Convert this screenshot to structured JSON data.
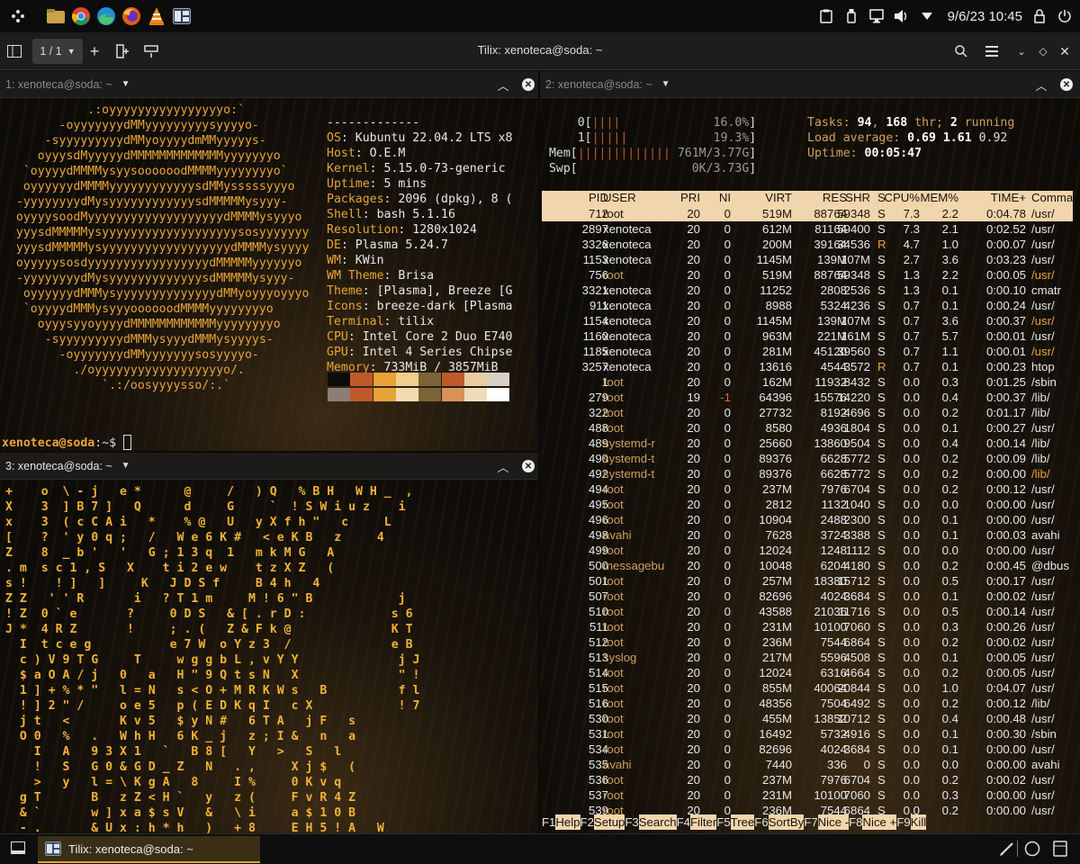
{
  "topbar": {
    "datetime": "9/6/23 10:45",
    "apps": [
      "app-launcher-icon",
      "file-manager-icon",
      "chrome-icon",
      "edge-icon",
      "firefox-icon",
      "vlc-icon",
      "tilix-icon"
    ]
  },
  "window": {
    "title": "Tilix: xenoteca@soda: ~",
    "session_label": "1 / 1"
  },
  "panes": {
    "p1": {
      "title": "1: xenoteca@soda: ~"
    },
    "p2": {
      "title": "2: xenoteca@soda: ~"
    },
    "p3": {
      "title": "3: xenoteca@soda: ~"
    }
  },
  "neofetch": {
    "separator": "-------------",
    "info": [
      {
        "k": "OS",
        "v": " Kubuntu 22.04.2 LTS x8"
      },
      {
        "k": "Host",
        "v": " O.E.M"
      },
      {
        "k": "Kernel",
        "v": " 5.15.0-73-generic"
      },
      {
        "k": "Uptime",
        "v": " 5 mins"
      },
      {
        "k": "Packages",
        "v": " 2096 (dpkg), 8 ("
      },
      {
        "k": "Shell",
        "v": " bash 5.1.16"
      },
      {
        "k": "Resolution",
        "v": " 1280x1024"
      },
      {
        "k": "DE",
        "v": " Plasma 5.24.7"
      },
      {
        "k": "WM",
        "v": " KWin"
      },
      {
        "k": "WM Theme",
        "v": " Brisa"
      },
      {
        "k": "Theme",
        "v": " [Plasma], Breeze [G"
      },
      {
        "k": "Icons",
        "v": " breeze-dark [Plasma"
      },
      {
        "k": "Terminal",
        "v": " tilix"
      },
      {
        "k": "CPU",
        "v": " Intel Core 2 Duo E740"
      },
      {
        "k": "GPU",
        "v": " Intel 4 Series Chipse"
      },
      {
        "k": "Memory",
        "v": " 733MiB / 3857MiB"
      }
    ],
    "logo": [
      "            .:oyyyyyyyyyyyyyyyyo:`",
      "        -oyyyyyyydMMyyyyyyyyysyyyyo-",
      "      -syyyyyyyyydMMyoyyyydmMMyyyyys-",
      "     oyyysdMyyyyydMMMMMMMMMMMMMyyyyyyyo",
      "   `oyyyydMMMMysyysoooooodMMMMyyyyyyyyo`",
      "   oyyyyyydMMMMyyyyyyyyyyyysdMMysssssyyyo",
      "  -yyyyyyyydMysyyyyyyyyyyyysdMMMMMysyyy-",
      "  oyyyysoodMyyyyyyyyyyyyyyyyyyydMMMMysyyyo",
      "  yyysdMMMMMysyyyyyyyyyyyyyyyyyyysosyyyyyyy",
      "  yyysdMMMMMysyyyyyyyyyyyyyyyyyydMMMMysyyyy",
      "  oyyyyysosdyyyyyyyyyyyyyyyyydMMMMMyyyyyyo",
      "  -yyyyyyyydMysyyyyyyyyyyyyysdMMMMMysyyy-",
      "   oyyyyyydMMMysyyyyyyyyyyyyyydMMyoyyyoyyyo",
      "   `oyyyydMMMysyyyoooooodMMMMyyyyyyyyo",
      "     oyyysyyoyyyydMMMMMMMMMMMMyyyyyyyyo",
      "      -syyyyyyyyydMMMysyyydMMMysyyyys-",
      "        -oyyyyyyydMMyyyyyyysosyyyyo-",
      "          ./oyyyyyyyyyyyyyyyyyyo/.",
      "              `.:/oosyyyysso/:.`"
    ],
    "palette_top": [
      "#0d0b08",
      "#c0592a",
      "#e8a338",
      "#f2cf8c",
      "#7c6438",
      "#c0592a",
      "#e8cca3",
      "#d9cfc4"
    ],
    "palette_bottom": [
      "#8a7f72",
      "#c0592a",
      "#e8a338",
      "#f5dcb0",
      "#7c6438",
      "#d8925a",
      "#f0dcbc",
      "#ffffff"
    ]
  },
  "prompt": {
    "user": "xenoteca@soda",
    "rest": ":~$ "
  },
  "matrix": [
    "+    o  \\ - j   e *      @     /   ) Q   % B H   W H _  ,",
    "X    3  ] B 7 ]   Q      d     G     `  ! S W i u z    i",
    "x    3  ( c C A i   *    % @   U   y X f h \"   c     L",
    "[    ?  ' y 0 q ;   /   W e 6 K #   < e K B   z     4",
    "Z    8  _ b '   '   G ; 1 3 q  1   m k M G   A",
    ". m  s c 1 , S   X    t i 2 e w    t z X Z   (",
    "s !    ! ]   ]     K   J D S f     B 4 h   4",
    "Z Z   ' ' R       i   ? T 1 m     M ! 6 \" B            j",
    "! Z  0 ` e       ?     0 D S   & [ . r D :            s 6",
    "J *  4 R Z       !     ; . (   Z & F k @              K T",
    "  I  t c e g           e 7 W  o Y z 3  /              e B",
    "  c ) V 9 T G     T     w g g b L , v Y Y              j J",
    "  $ a O A / j   0   a   H \" 9 Q t s N   X              \" !",
    "  1 ] + % * \"   l = N   s < O + M R K W s   B          f l",
    "  ! ] 2 \" /     o e 5   p ( E D K q I   c X            ! 7",
    "  j t   <       K v 5   $ y N #   6 T A   j F   s",
    "  O 0   %   .   W h H   6 K _ j   z ; I &   n   a",
    "    I   A   9 3 X 1   `   B 8 [   Y   >   S   l",
    "    !   S   G 0 & G D _ Z   N   . ,     X j $   (",
    "    >   y   l = \\ K g A   8     I %     0 K v q",
    "  g T       B   z Z < H `   y   z (     F v R 4 Z",
    "  & `       w ] x a $ s V   &   \\ i     a $ 1 0 B",
    "  - .       & U x : h * h   )   + 8     E H 5 ! A   W"
  ],
  "htop": {
    "cpu0": {
      "label": "0",
      "bar": "||||",
      "pct": "16.0%"
    },
    "cpu1": {
      "label": "1",
      "bar": "|||||",
      "pct": "19.3%"
    },
    "mem": {
      "label": "Mem",
      "bar": "|||||||||||||",
      "val": "761M/3.77G"
    },
    "swp": {
      "label": "Swp",
      "bar": "",
      "val": "0K/3.73G"
    },
    "tasks": {
      "label": "Tasks: ",
      "n": "94",
      "sep": ", ",
      "thr": "168",
      "thr_label": " thr; ",
      "running": "2",
      "running_label": " running"
    },
    "load": {
      "label": "Load average: ",
      "l1": "0.69",
      "l5": "1.61",
      "l15": "0.92"
    },
    "uptime": {
      "label": "Uptime: ",
      "val": "00:05:47"
    },
    "headers": [
      "PID",
      "USER",
      "PRI",
      "NI",
      "VIRT",
      "RES",
      "SHR",
      "S",
      "CPU%",
      "MEM%",
      "TIME+",
      "Comma"
    ],
    "rows": [
      [
        "712",
        "root",
        "20",
        "0",
        "519M",
        "88764",
        "59348",
        "S",
        "7.3",
        "2.2",
        "0:04.78",
        "/usr/"
      ],
      [
        "2897",
        "xenoteca",
        "20",
        "0",
        "612M",
        "81164",
        "59400",
        "S",
        "7.3",
        "2.1",
        "0:02.52",
        "/usr/"
      ],
      [
        "3326",
        "xenoteca",
        "20",
        "0",
        "200M",
        "39164",
        "34536",
        "R",
        "4.7",
        "1.0",
        "0:00.07",
        "/usr/"
      ],
      [
        "1153",
        "xenoteca",
        "20",
        "0",
        "1145M",
        "139M",
        "107M",
        "S",
        "2.7",
        "3.6",
        "0:03.23",
        "/usr/"
      ],
      [
        "756",
        "root",
        "20",
        "0",
        "519M",
        "88764",
        "59348",
        "S",
        "1.3",
        "2.2",
        "0:00.05",
        "/usr/"
      ],
      [
        "3321",
        "xenoteca",
        "20",
        "0",
        "11252",
        "2808",
        "2536",
        "S",
        "1.3",
        "0.1",
        "0:00.10",
        "cmatr"
      ],
      [
        "911",
        "xenoteca",
        "20",
        "0",
        "8988",
        "5324",
        "4236",
        "S",
        "0.7",
        "0.1",
        "0:00.24",
        "/usr/"
      ],
      [
        "1154",
        "xenoteca",
        "20",
        "0",
        "1145M",
        "139M",
        "107M",
        "S",
        "0.7",
        "3.6",
        "0:00.37",
        "/usr/"
      ],
      [
        "1160",
        "xenoteca",
        "20",
        "0",
        "963M",
        "221M",
        "161M",
        "S",
        "0.7",
        "5.7",
        "0:00.01",
        "/usr/"
      ],
      [
        "1185",
        "xenoteca",
        "20",
        "0",
        "281M",
        "45120",
        "39560",
        "S",
        "0.7",
        "1.1",
        "0:00.01",
        "/usr/"
      ],
      [
        "3257",
        "xenoteca",
        "20",
        "0",
        "13616",
        "4544",
        "3572",
        "R",
        "0.7",
        "0.1",
        "0:00.23",
        "htop"
      ],
      [
        "1",
        "root",
        "20",
        "0",
        "162M",
        "11932",
        "8432",
        "S",
        "0.0",
        "0.3",
        "0:01.25",
        "/sbin"
      ],
      [
        "279",
        "root",
        "19",
        "-1",
        "64396",
        "15576",
        "14220",
        "S",
        "0.0",
        "0.4",
        "0:00.37",
        "/lib/"
      ],
      [
        "322",
        "root",
        "20",
        "0",
        "27732",
        "8192",
        "4696",
        "S",
        "0.0",
        "0.2",
        "0:01.17",
        "/lib/"
      ],
      [
        "488",
        "root",
        "20",
        "0",
        "8580",
        "4936",
        "1804",
        "S",
        "0.0",
        "0.1",
        "0:00.27",
        "/usr/"
      ],
      [
        "489",
        "systemd-r",
        "20",
        "0",
        "25660",
        "13860",
        "9504",
        "S",
        "0.0",
        "0.4",
        "0:00.14",
        "/lib/"
      ],
      [
        "490",
        "systemd-t",
        "20",
        "0",
        "89376",
        "6628",
        "5772",
        "S",
        "0.0",
        "0.2",
        "0:00.09",
        "/lib/"
      ],
      [
        "492",
        "systemd-t",
        "20",
        "0",
        "89376",
        "6628",
        "5772",
        "S",
        "0.0",
        "0.2",
        "0:00.00",
        "/lib/"
      ],
      [
        "494",
        "root",
        "20",
        "0",
        "237M",
        "7976",
        "6704",
        "S",
        "0.0",
        "0.2",
        "0:00.12",
        "/usr/"
      ],
      [
        "495",
        "root",
        "20",
        "0",
        "2812",
        "1132",
        "1040",
        "S",
        "0.0",
        "0.0",
        "0:00.00",
        "/usr/"
      ],
      [
        "496",
        "root",
        "20",
        "0",
        "10904",
        "2488",
        "2300",
        "S",
        "0.0",
        "0.1",
        "0:00.00",
        "/usr/"
      ],
      [
        "498",
        "avahi",
        "20",
        "0",
        "7628",
        "3724",
        "3388",
        "S",
        "0.0",
        "0.1",
        "0:00.03",
        "avahi"
      ],
      [
        "499",
        "root",
        "20",
        "0",
        "12024",
        "1248",
        "1112",
        "S",
        "0.0",
        "0.0",
        "0:00.00",
        "/usr/"
      ],
      [
        "500",
        "messagebu",
        "20",
        "0",
        "10048",
        "6204",
        "4180",
        "S",
        "0.0",
        "0.2",
        "0:00.45",
        "@dbus"
      ],
      [
        "501",
        "root",
        "20",
        "0",
        "257M",
        "18380",
        "15712",
        "S",
        "0.0",
        "0.5",
        "0:00.17",
        "/usr/"
      ],
      [
        "507",
        "root",
        "20",
        "0",
        "82696",
        "4024",
        "3684",
        "S",
        "0.0",
        "0.1",
        "0:00.02",
        "/usr/"
      ],
      [
        "510",
        "root",
        "20",
        "0",
        "43588",
        "21036",
        "11716",
        "S",
        "0.0",
        "0.5",
        "0:00.14",
        "/usr/"
      ],
      [
        "511",
        "root",
        "20",
        "0",
        "231M",
        "10100",
        "7060",
        "S",
        "0.0",
        "0.3",
        "0:00.26",
        "/usr/"
      ],
      [
        "512",
        "root",
        "20",
        "0",
        "236M",
        "7544",
        "6864",
        "S",
        "0.0",
        "0.2",
        "0:00.02",
        "/usr/"
      ],
      [
        "513",
        "syslog",
        "20",
        "0",
        "217M",
        "5596",
        "4508",
        "S",
        "0.0",
        "0.1",
        "0:00.05",
        "/usr/"
      ],
      [
        "514",
        "root",
        "20",
        "0",
        "12024",
        "6316",
        "4664",
        "S",
        "0.0",
        "0.2",
        "0:00.05",
        "/usr/"
      ],
      [
        "515",
        "root",
        "20",
        "0",
        "855M",
        "40064",
        "20844",
        "S",
        "0.0",
        "1.0",
        "0:04.07",
        "/usr/"
      ],
      [
        "516",
        "root",
        "20",
        "0",
        "48356",
        "7504",
        "6492",
        "S",
        "0.0",
        "0.2",
        "0:00.12",
        "/lib/"
      ],
      [
        "530",
        "root",
        "20",
        "0",
        "455M",
        "13852",
        "10712",
        "S",
        "0.0",
        "0.4",
        "0:00.48",
        "/usr/"
      ],
      [
        "531",
        "root",
        "20",
        "0",
        "16492",
        "5732",
        "4916",
        "S",
        "0.0",
        "0.1",
        "0:00.30",
        "/sbin"
      ],
      [
        "534",
        "root",
        "20",
        "0",
        "82696",
        "4024",
        "3684",
        "S",
        "0.0",
        "0.1",
        "0:00.00",
        "/usr/"
      ],
      [
        "535",
        "avahi",
        "20",
        "0",
        "7440",
        "336",
        "0",
        "S",
        "0.0",
        "0.0",
        "0:00.00",
        "avahi"
      ],
      [
        "536",
        "root",
        "20",
        "0",
        "237M",
        "7976",
        "6704",
        "S",
        "0.0",
        "0.2",
        "0:00.02",
        "/usr/"
      ],
      [
        "537",
        "root",
        "20",
        "0",
        "231M",
        "10100",
        "7060",
        "S",
        "0.0",
        "0.3",
        "0:00.00",
        "/usr/"
      ],
      [
        "539",
        "root",
        "20",
        "0",
        "236M",
        "7544",
        "6864",
        "S",
        "0.0",
        "0.2",
        "0:00.00",
        "/usr/"
      ]
    ],
    "fkeys": [
      {
        "k": "F1",
        "l": "Help  "
      },
      {
        "k": "F2",
        "l": "Setup "
      },
      {
        "k": "F3",
        "l": "Search"
      },
      {
        "k": "F4",
        "l": "Filter"
      },
      {
        "k": "F5",
        "l": "Tree  "
      },
      {
        "k": "F6",
        "l": "SortBy"
      },
      {
        "k": "F7",
        "l": "Nice -"
      },
      {
        "k": "F8",
        "l": "Nice +"
      },
      {
        "k": "F9",
        "l": "Kill"
      }
    ]
  },
  "taskbar": {
    "task_label": "Tilix: xenoteca@soda: ~"
  }
}
